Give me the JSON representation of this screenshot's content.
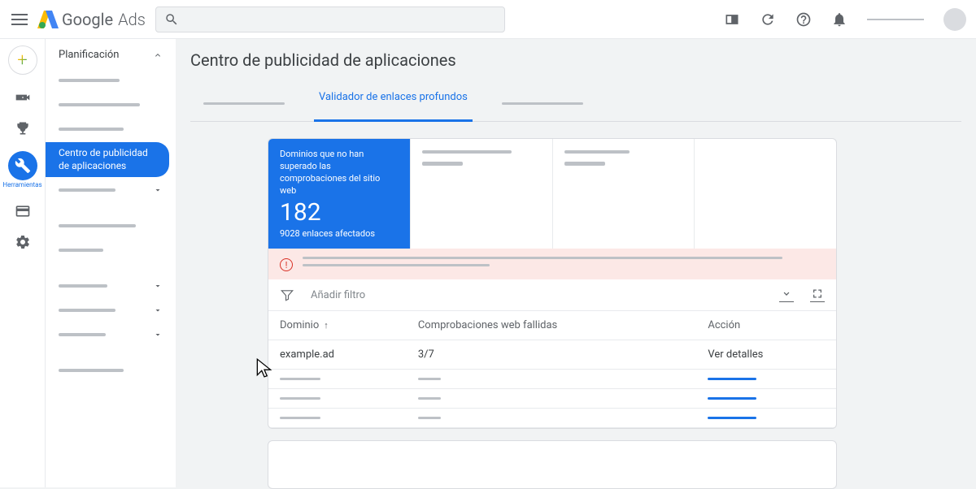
{
  "header": {
    "product_name": "Google",
    "product_suffix": "Ads"
  },
  "rail": {
    "tools_label": "Herramientas"
  },
  "side_panel": {
    "section_title": "Planificación",
    "active_item": "Centro de publicidad de aplicaciones"
  },
  "page": {
    "title": "Centro de publicidad de aplicaciones",
    "active_tab": "Validador de enlaces profundos"
  },
  "stats": {
    "primary_label": "Dominios que no han superado las comprobaciones del sitio web",
    "primary_value": "182",
    "primary_sub": "9028 enlaces afectados"
  },
  "filter": {
    "placeholder": "Añadir filtro"
  },
  "table": {
    "columns": {
      "domain": "Dominio",
      "failed": "Comprobaciones web fallidas",
      "action": "Acción"
    },
    "rows": [
      {
        "domain": "example.ad",
        "failed": "3/7",
        "action": "Ver detalles"
      }
    ]
  }
}
